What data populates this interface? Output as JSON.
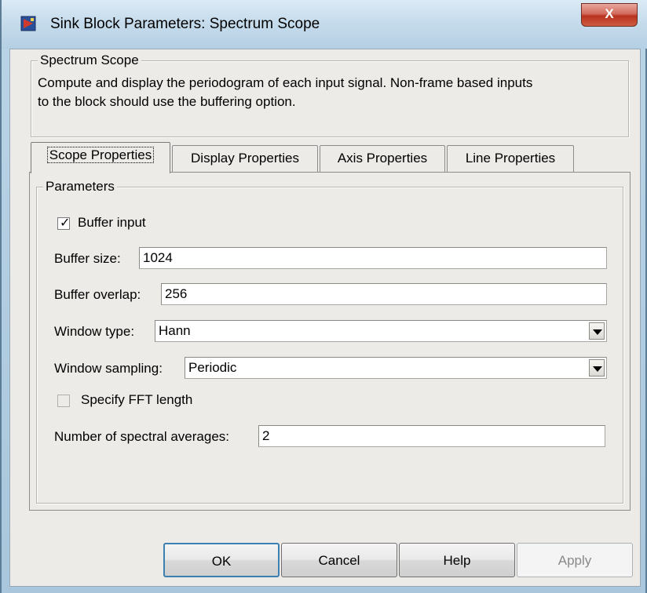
{
  "window": {
    "title": "Sink Block Parameters: Spectrum Scope",
    "close_label": "X"
  },
  "block": {
    "group_title": "Spectrum Scope",
    "description_line1": "Compute and display the periodogram of each input signal.  Non-frame based inputs",
    "description_line2": "to the block should use the buffering option."
  },
  "tabs": [
    {
      "label": "Scope Properties",
      "active": true
    },
    {
      "label": "Display Properties",
      "active": false
    },
    {
      "label": "Axis Properties",
      "active": false
    },
    {
      "label": "Line Properties",
      "active": false
    }
  ],
  "parameters": {
    "group_title": "Parameters",
    "buffer_input": {
      "label": "Buffer input",
      "checked": true
    },
    "buffer_size": {
      "label": "Buffer size:",
      "value": "1024"
    },
    "buffer_overlap": {
      "label": "Buffer overlap:",
      "value": "256"
    },
    "window_type": {
      "label": "Window type:",
      "value": "Hann"
    },
    "window_sampling": {
      "label": "Window sampling:",
      "value": "Periodic"
    },
    "specify_fft": {
      "label": "Specify FFT length",
      "checked": false
    },
    "spectral_averages": {
      "label": "Number of spectral averages:",
      "value": "2"
    }
  },
  "buttons": {
    "ok": "OK",
    "cancel": "Cancel",
    "help": "Help",
    "apply": "Apply"
  },
  "icons": {
    "app": "simulink-block-icon",
    "close": "close-icon",
    "dropdown": "chevron-down-icon",
    "checkmark": "checkmark-icon"
  }
}
